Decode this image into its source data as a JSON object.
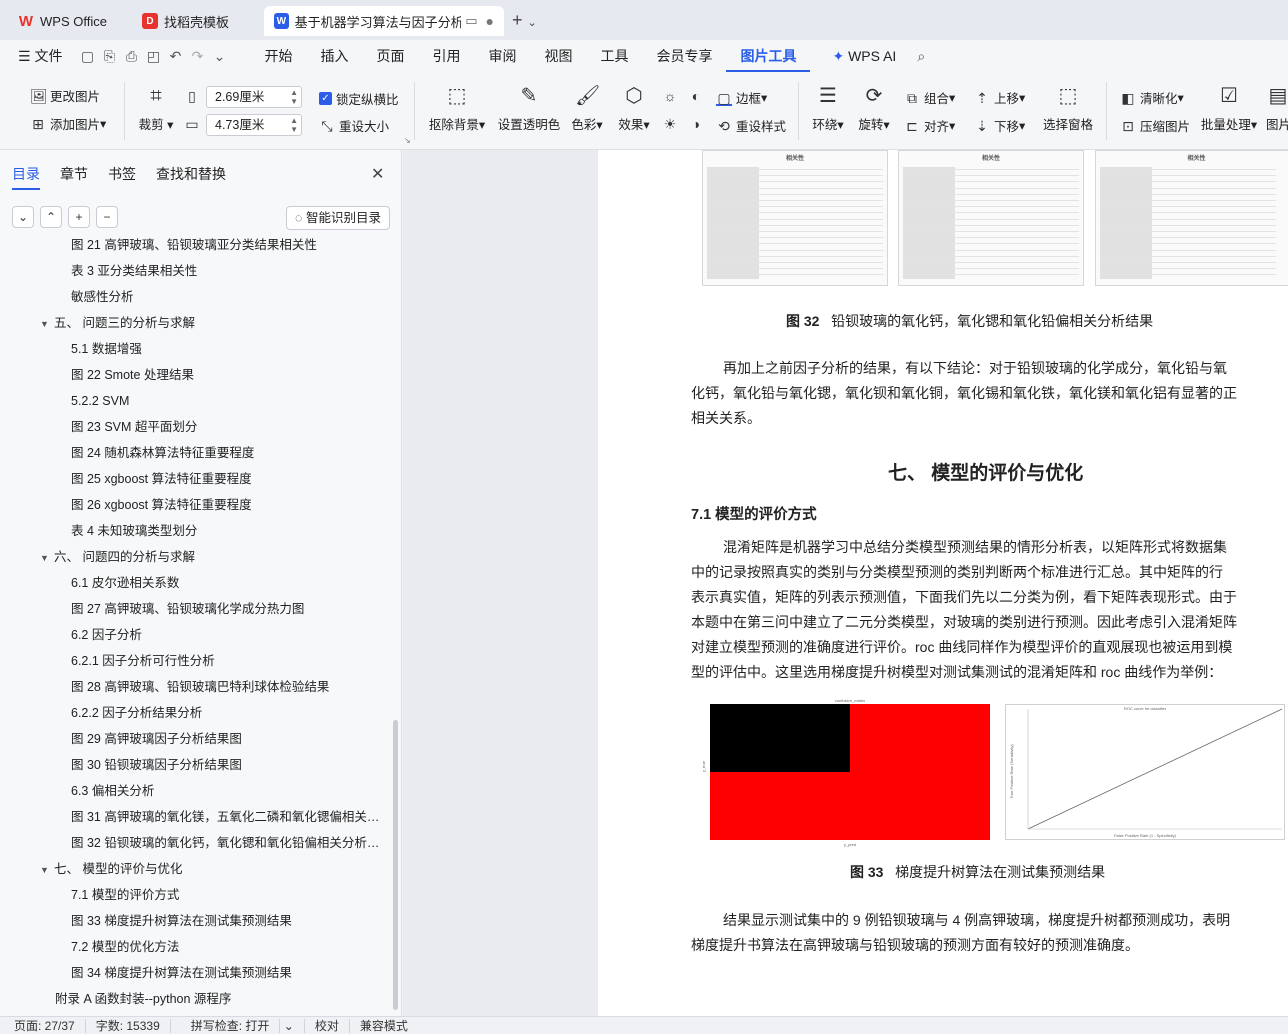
{
  "tabs": [
    {
      "label": "WPS Office",
      "icon": "wps-logo-icon"
    },
    {
      "label": "找稻壳模板",
      "icon": "docer-icon"
    },
    {
      "label": "基于机器学习算法与因子分析的",
      "icon": "word-doc-icon"
    }
  ],
  "menu": {
    "file": "文件",
    "items": [
      "开始",
      "插入",
      "页面",
      "引用",
      "审阅",
      "视图",
      "工具",
      "会员专享",
      "图片工具"
    ],
    "active": "图片工具",
    "wps_ai": "WPS AI"
  },
  "ribbon": {
    "change_picture": "更改图片",
    "add_picture": "添加图片",
    "crop": "裁剪",
    "height_value": "2.69厘米",
    "width_value": "4.73厘米",
    "lock_ratio": "锁定纵横比",
    "reset_size": "重设大小",
    "remove_bg": "抠除背景",
    "set_transparent": "设置透明色",
    "color": "色彩",
    "effect": "效果",
    "border": "边框",
    "reset_style": "重设样式",
    "wrap": "环绕",
    "rotate": "旋转",
    "group": "组合",
    "align": "对齐",
    "move_up": "上移",
    "move_down": "下移",
    "selection_pane": "选择窗格",
    "sharpen": "清晰化",
    "compress": "压缩图片",
    "batch": "批量处理",
    "more": "图片"
  },
  "sidebar": {
    "tabs": [
      "目录",
      "章节",
      "书签",
      "查找和替换"
    ],
    "active_tab": "目录",
    "smart_toc": "智能识别目录",
    "toc": [
      {
        "label": "图 21 高钾玻璃、铅钡玻璃亚分类结果相关性",
        "level": 3
      },
      {
        "label": "表 3 亚分类结果相关性",
        "level": 3
      },
      {
        "label": "敏感性分析",
        "level": 3
      },
      {
        "label": "五、 问题三的分析与求解",
        "level": 1
      },
      {
        "label": "5.1 数据增强",
        "level": 2
      },
      {
        "label": "图 22 Smote 处理结果",
        "level": 2
      },
      {
        "label": "5.2.2 SVM",
        "level": 2
      },
      {
        "label": "图 23 SVM 超平面划分",
        "level": 2
      },
      {
        "label": "图 24 随机森林算法特征重要程度",
        "level": 2
      },
      {
        "label": "图 25 xgboost 算法特征重要程度",
        "level": 2
      },
      {
        "label": "图 26 xgboost 算法特征重要程度",
        "level": 2
      },
      {
        "label": "表 4 未知玻璃类型划分",
        "level": 2
      },
      {
        "label": "六、 问题四的分析与求解",
        "level": 1
      },
      {
        "label": "6.1 皮尔逊相关系数",
        "level": 2
      },
      {
        "label": "图 27 高钾玻璃、铅钡玻璃化学成分热力图",
        "level": 2
      },
      {
        "label": "6.2 因子分析",
        "level": 2
      },
      {
        "label": "6.2.1 因子分析可行性分析",
        "level": 2
      },
      {
        "label": "图 28 高钾玻璃、铅钡玻璃巴特利球体检验结果",
        "level": 2
      },
      {
        "label": "6.2.2 因子分析结果分析",
        "level": 2
      },
      {
        "label": "图 29 高钾玻璃因子分析结果图",
        "level": 2
      },
      {
        "label": "图 30 铅钡玻璃因子分析结果图",
        "level": 2
      },
      {
        "label": "6.3 偏相关分析",
        "level": 2
      },
      {
        "label": "图 31 高钾玻璃的氧化镁，五氧化二磷和氧化锶偏相关分...",
        "level": 2
      },
      {
        "label": "图 32 铅钡玻璃的氧化钙，氧化锶和氧化铅偏相关分析结...",
        "level": 2
      },
      {
        "label": "七、 模型的评价与优化",
        "level": 1
      },
      {
        "label": "7.1 模型的评价方式",
        "level": 2
      },
      {
        "label": "图 33 梯度提升树算法在测试集预测结果",
        "level": 2
      },
      {
        "label": "7.2 模型的优化方法",
        "level": 2
      },
      {
        "label": "图 34 梯度提升树算法在测试集预测结果",
        "level": 2
      },
      {
        "label": "附录 A 函数封装--python 源程序",
        "level": 0
      }
    ]
  },
  "document": {
    "table_header": "相关性",
    "fig32_num": "图 32",
    "fig32_caption": "铅钡玻璃的氧化钙，氧化锶和氧化铅偏相关分析结果",
    "para1": [
      "再加上之前因子分析的结果，有以下结论：对于铅钡玻璃的化学成分，氧化铅与氧",
      "化钙，氧化铅与氧化锶，氧化钡和氧化铜，氧化锡和氧化铁，氧化镁和氧化铝有显著的正",
      "相关关系。"
    ],
    "heading7": "七、 模型的评价与优化",
    "heading71": "7.1 模型的评价方式",
    "para2": [
      "混淆矩阵是机器学习中总结分类模型预测结果的情形分析表，以矩阵形式将数据集",
      "中的记录按照真实的类别与分类模型预测的类别判断两个标准进行汇总。其中矩阵的行",
      "表示真实值，矩阵的列表示预测值，下面我们先以二分类为例，看下矩阵表现形式。由于",
      "本题中在第三问中建立了二元分类模型，对玻璃的类别进行预测。因此考虑引入混淆矩阵",
      "对建立模型预测的准确度进行评价。roc 曲线同样作为模型评价的直观展现也被运用到模",
      "型的评估中。这里选用梯度提升树模型对测试集测试的混淆矩阵和 roc 曲线作为举例："
    ],
    "fig33_num": "图 33",
    "fig33_caption": "梯度提升树算法在测试集预测结果",
    "para3": [
      "结果显示测试集中的 9 例铅钡玻璃与 4 例高钾玻璃，梯度提升树都预测成功，表明",
      "梯度提升书算法在高钾玻璃与铅钡玻璃的预测方面有较好的预测准确度。"
    ],
    "cm_title": "confusion_matrix",
    "cm_xlabel": "y_pred",
    "cm_ylabel": "y_true",
    "roc_title": "ROC curve for classifier",
    "roc_xlabel": "False Positive Rate (1 - Specificity)",
    "roc_ylabel": "True Positive Rate (Sensitivity)"
  },
  "status": {
    "page": "页面: 27/37",
    "words": "字数: 15339",
    "spell": "拼写检查: 打开",
    "proof": "校对",
    "compat": "兼容模式"
  },
  "colors": {
    "accent": "#2b5ee8",
    "wps_red": "#e8322d",
    "cm_red": "#ff0000",
    "cm_black": "#000000"
  }
}
